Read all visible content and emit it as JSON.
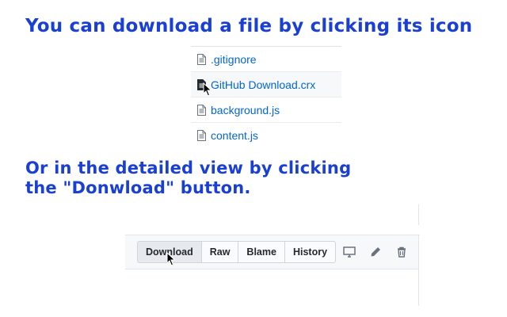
{
  "headline_1": "You can download a file by clicking its icon",
  "headline_2": "Or in the detailed view by clicking the \"Donwload\" button.",
  "files": [
    {
      "name": ".gitignore",
      "icon": "file-icon"
    },
    {
      "name": "GitHub Download.crx",
      "icon": "file-download-icon",
      "hover": true
    },
    {
      "name": "background.js",
      "icon": "file-icon"
    },
    {
      "name": "content.js",
      "icon": "file-icon"
    }
  ],
  "toolbar": {
    "buttons": [
      {
        "label": "Download",
        "active": true
      },
      {
        "label": "Raw"
      },
      {
        "label": "Blame"
      },
      {
        "label": "History"
      }
    ],
    "icons": [
      "desktop-icon",
      "pencil-icon",
      "trash-icon"
    ]
  },
  "colors": {
    "headline": "#1a3fd4",
    "link": "#0366d6",
    "icon": "#6a737d"
  }
}
